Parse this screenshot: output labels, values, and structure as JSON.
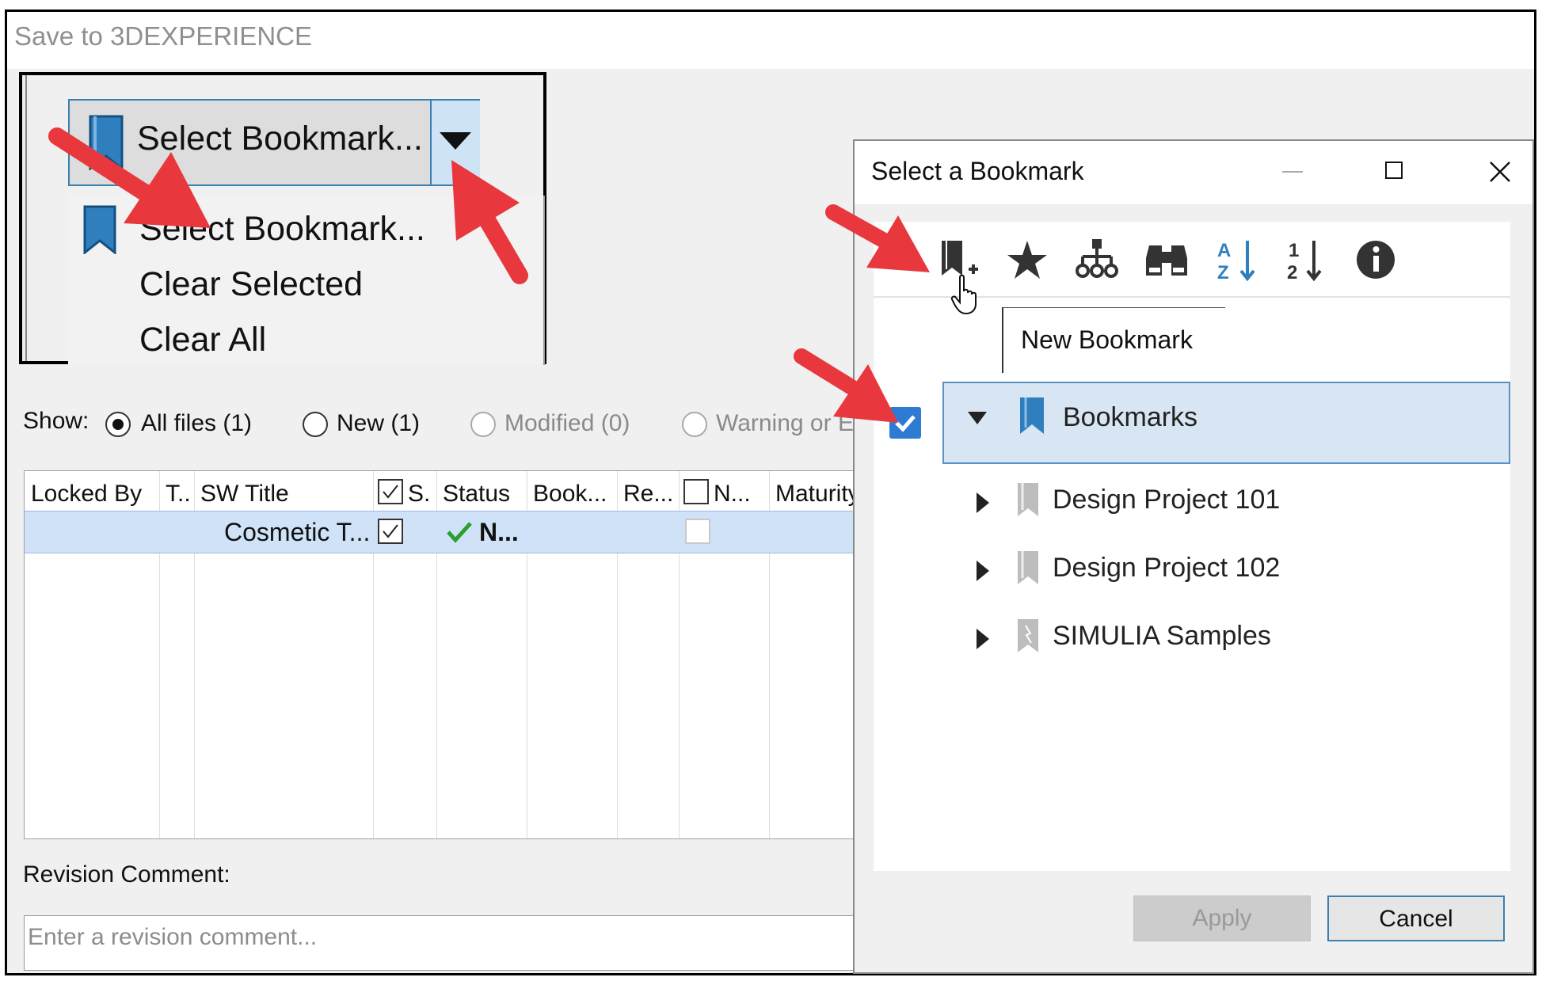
{
  "window": {
    "title": "Save to 3DEXPERIENCE"
  },
  "bookmark_dropdown": {
    "button_label": "Select Bookmark...",
    "menu_items": [
      "Select Bookmark...",
      "Clear Selected",
      "Clear All"
    ]
  },
  "show_filter": {
    "label": "Show:",
    "options": [
      {
        "label": "All files (1)",
        "selected": true,
        "enabled": true
      },
      {
        "label": "New (1)",
        "selected": false,
        "enabled": true
      },
      {
        "label": "Modified (0)",
        "selected": false,
        "enabled": false
      },
      {
        "label": "Warning or E",
        "selected": false,
        "enabled": false
      }
    ]
  },
  "grid": {
    "columns": [
      "Locked By",
      "T..",
      "SW Title",
      "S.",
      "Status",
      "Book...",
      "Re...",
      "N...",
      "Maturity"
    ],
    "rows": [
      {
        "sw_title": "Cosmetic T...",
        "save_checked": true,
        "status": "N...",
        "new_checked": false
      }
    ]
  },
  "revision": {
    "label": "Revision Comment:",
    "placeholder": "Enter a revision comment..."
  },
  "bookmark_dialog": {
    "title": "Select a Bookmark",
    "toolbar_icons": [
      "new-bookmark-icon",
      "favorite-star-icon",
      "hierarchy-icon",
      "binoculars-icon",
      "sort-alpha-icon",
      "sort-numeric-icon",
      "info-icon"
    ],
    "tooltip": "New Bookmark",
    "root": {
      "label": "Bookmarks",
      "checked": true
    },
    "children": [
      "Design Project 101",
      "Design Project 102",
      "SIMULIA Samples"
    ],
    "apply_label": "Apply",
    "cancel_label": "Cancel"
  },
  "colors": {
    "accent": "#3c7fb1",
    "selection": "#cfe2f8",
    "arrow": "#e8383d",
    "bookmark_blue": "#2f7fbf"
  }
}
